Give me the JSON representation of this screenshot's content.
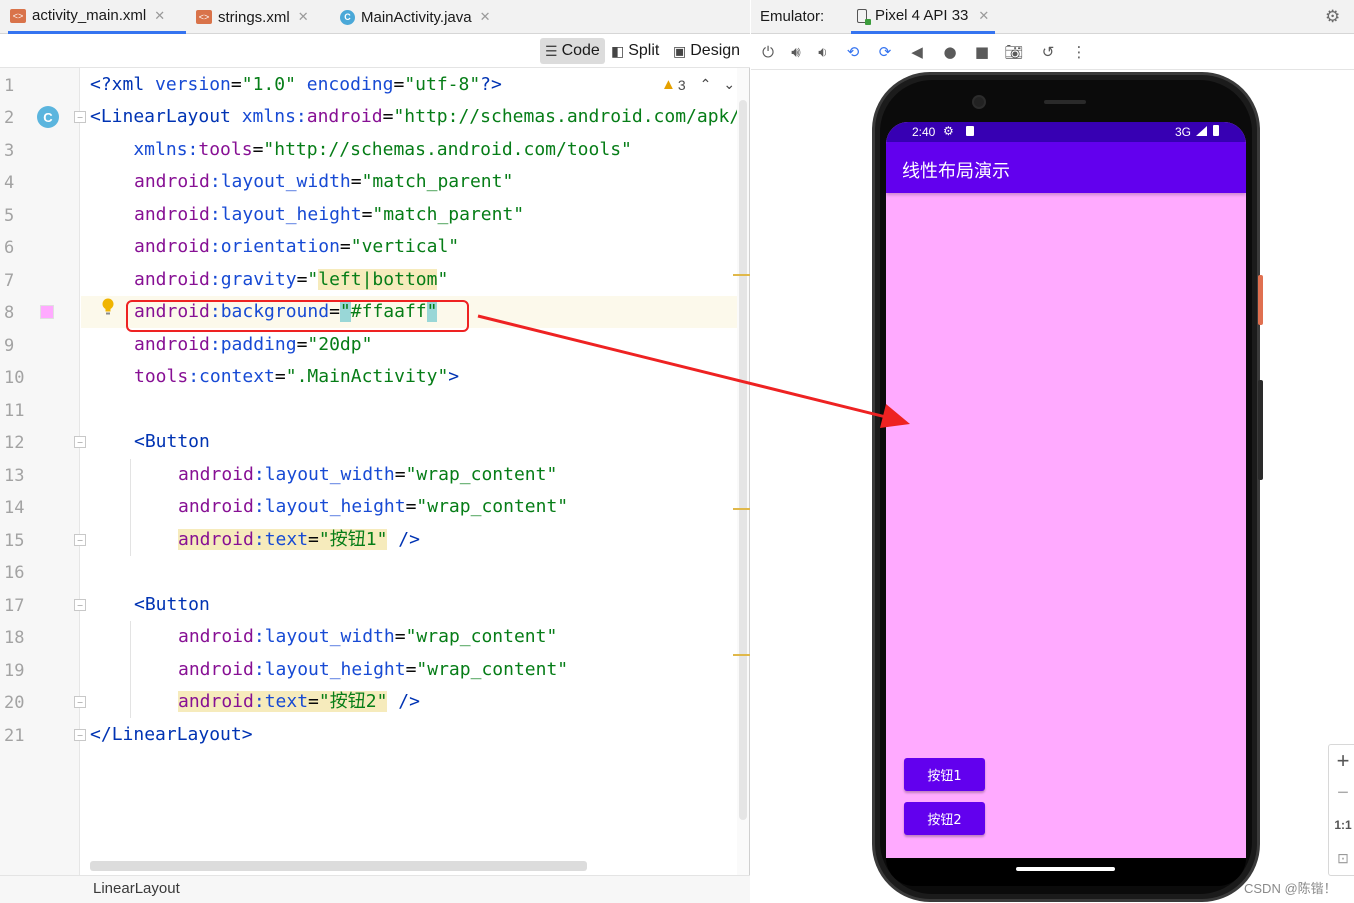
{
  "editor_tabs": [
    {
      "label": "activity_main.xml",
      "icon": "xml-file-icon",
      "active": true
    },
    {
      "label": "strings.xml",
      "icon": "xml-file-icon",
      "active": false
    },
    {
      "label": "MainActivity.java",
      "icon": "java-class-icon",
      "active": false
    }
  ],
  "view_modes": {
    "code": "Code",
    "split": "Split",
    "design": "Design"
  },
  "warnings": {
    "count": "3"
  },
  "line_numbers": [
    "1",
    "2",
    "3",
    "4",
    "5",
    "6",
    "7",
    "8",
    "9",
    "10",
    "11",
    "12",
    "13",
    "14",
    "15",
    "16",
    "17",
    "18",
    "19",
    "20",
    "21"
  ],
  "gutter": {
    "class_badge": "C",
    "color_swatch": "#ffaaff"
  },
  "code": {
    "l1": {
      "a": "<?xml ",
      "b": "version",
      "c": "=",
      "d": "\"1.0\"",
      "e": " encoding",
      "f": "=",
      "g": "\"utf-8\"",
      "h": "?>"
    },
    "l2": {
      "a": "<LinearLayout ",
      "b": "xmlns:",
      "c": "android",
      "d": "=",
      "e": "\"http://schemas.android.com/apk/"
    },
    "l3": {
      "a": "    xmlns:",
      "b": "tools",
      "c": "=",
      "d": "\"http://schemas.android.com/tools\""
    },
    "l4": {
      "ns": "android",
      "attr": ":layout_width",
      "eq": "=",
      "val": "\"match_parent\""
    },
    "l5": {
      "ns": "android",
      "attr": ":layout_height",
      "eq": "=",
      "val": "\"match_parent\""
    },
    "l6": {
      "ns": "android",
      "attr": ":orientation",
      "eq": "=",
      "val": "\"vertical\""
    },
    "l7": {
      "ns": "android",
      "attr": ":gravity",
      "eq": "=",
      "q1": "\"",
      "val": "left|bottom",
      "q2": "\""
    },
    "l8": {
      "ns": "android",
      "attr": ":background",
      "eq": "=",
      "q1": "\"",
      "val": "#ffaaff",
      "q2": "\""
    },
    "l9": {
      "ns": "android",
      "attr": ":padding",
      "eq": "=",
      "val": "\"20dp\""
    },
    "l10": {
      "ns": "tools",
      "attr": ":context",
      "eq": "=",
      "val": "\".MainActivity\"",
      "end": ">"
    },
    "l12": {
      "tag": "<Button"
    },
    "l13": {
      "ns": "android",
      "attr": ":layout_width",
      "eq": "=",
      "val": "\"wrap_content\""
    },
    "l14": {
      "ns": "android",
      "attr": ":layout_height",
      "eq": "=",
      "val": "\"wrap_content\""
    },
    "l15": {
      "ns": "android",
      "attr": ":text",
      "eq": "=",
      "val": "\"按钮1\"",
      "end": " />"
    },
    "l17": {
      "tag": "<Button"
    },
    "l18": {
      "ns": "android",
      "attr": ":layout_width",
      "eq": "=",
      "val": "\"wrap_content\""
    },
    "l19": {
      "ns": "android",
      "attr": ":layout_height",
      "eq": "=",
      "val": "\"wrap_content\""
    },
    "l20": {
      "ns": "android",
      "attr": ":text",
      "eq": "=",
      "val": "\"按钮2\"",
      "end": " />"
    },
    "l21": {
      "a": "</",
      "b": "LinearLayout",
      "c": ">"
    }
  },
  "breadcrumb": "LinearLayout",
  "emulator": {
    "label": "Emulator:",
    "device_tab": "Pixel 4 API 33",
    "toolbar_icons": [
      "power-icon",
      "volume-up-icon",
      "volume-down-icon",
      "rotate-left-icon",
      "rotate-right-icon",
      "back-icon",
      "home-icon",
      "overview-icon",
      "screenshot-icon",
      "snapshot-icon",
      "more-icon"
    ]
  },
  "phone": {
    "status_time": "2:40",
    "network": "3G",
    "app_title": "线性布局演示",
    "buttons": [
      "按钮1",
      "按钮2"
    ],
    "screen_bg": "#ffaaff",
    "appbar_color": "#6200ee",
    "statusbar_color": "#3700b3"
  },
  "zoom": {
    "in": "+",
    "out": "−",
    "actual": "1:1"
  },
  "watermark": "CSDN @陈锴！",
  "colors": {
    "highlight_box": "#ee2222",
    "accent": "#3574f0"
  }
}
